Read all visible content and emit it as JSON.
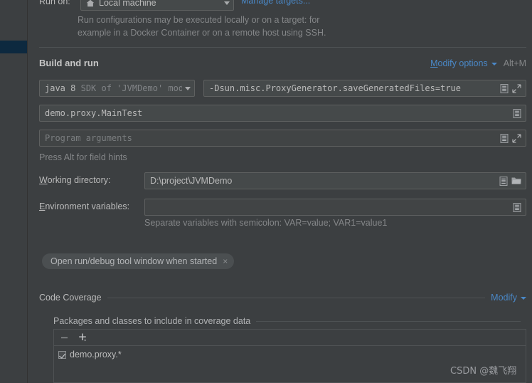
{
  "colors": {
    "background": "#3c3f41",
    "field_background": "#45494a",
    "border": "#5e6060",
    "link": "#4a88c7",
    "selection": "#0d293f",
    "text": "#bbbbbb",
    "text_dim": "#848688"
  },
  "run_on": {
    "label": "Run on:",
    "selected": "Local machine",
    "icon": "home-icon",
    "manage_targets_link": "Manage targets..."
  },
  "description": {
    "line1": "Run configurations may be executed locally or on a target: for",
    "line2": "example in a Docker Container or on a remote host using SSH."
  },
  "build_and_run": {
    "title": "Build and run",
    "modify_options_label": "Modify options",
    "modify_options_shortcut": "Alt+M",
    "jre": {
      "value_strong": "java 8",
      "value_dim": "SDK of 'JVMDemo' modu"
    },
    "vm_options": {
      "value": "-Dsun.misc.ProxyGenerator.saveGeneratedFiles=true",
      "placeholder": ""
    },
    "main_class": {
      "value": "demo.proxy.MainTest",
      "placeholder": ""
    },
    "program_arguments": {
      "value": "",
      "placeholder": "Program arguments"
    },
    "hint": "Press Alt for field hints",
    "working_directory": {
      "label": "Working directory:",
      "label_mnemonic": "W",
      "label_rest": "orking directory:",
      "value": "D:\\project\\JVMDemo"
    },
    "environment_variables": {
      "label_mnemonic": "E",
      "label_rest": "nvironment variables:",
      "value": "",
      "placeholder": ""
    },
    "env_hint": "Separate variables with semicolon: VAR=value; VAR1=value1"
  },
  "chip": {
    "label": "Open run/debug tool window when started",
    "close_glyph": "×"
  },
  "code_coverage": {
    "title": "Code Coverage",
    "modify_label": "Modify",
    "packages_title": "Packages and classes to include in coverage data",
    "remove_glyph": "−",
    "add_glyph": "+",
    "items": [
      {
        "checked": true,
        "label": "demo.proxy.*"
      }
    ]
  },
  "watermark": "CSDN @魏飞翔"
}
